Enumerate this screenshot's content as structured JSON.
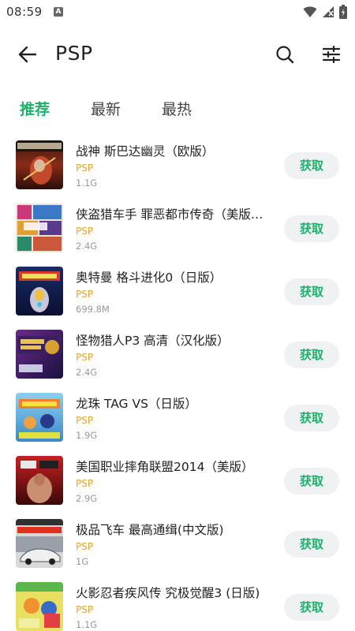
{
  "status_bar": {
    "time": "08:59",
    "notification_letter": "A",
    "icons": [
      "wifi-icon",
      "signal-icon",
      "battery-icon"
    ]
  },
  "header": {
    "title": "PSP",
    "back_icon": "arrow-left-icon",
    "search_icon": "search-icon",
    "filter_icon": "sliders-icon"
  },
  "tabs": [
    {
      "label": "推荐",
      "active": true
    },
    {
      "label": "最新",
      "active": false
    },
    {
      "label": "最热",
      "active": false
    }
  ],
  "colors": {
    "accent": "#1bb36a",
    "platform": "#e6a72a",
    "button_bg": "#f0f1f2"
  },
  "games": [
    {
      "title": "战神 斯巴达幽灵（欧版）",
      "platform": "PSP",
      "size": "1.1G",
      "button": "获取",
      "cover": "god-of-war-cover"
    },
    {
      "title": "侠盗猎车手 罪恶都市传奇（美版…",
      "platform": "PSP",
      "size": "2.4G",
      "button": "获取",
      "cover": "gta-vice-city-cover"
    },
    {
      "title": "奥特曼 格斗进化0（日版）",
      "platform": "PSP",
      "size": "699.8M",
      "button": "获取",
      "cover": "ultraman-cover"
    },
    {
      "title": "怪物猎人P3 高清（汉化版）",
      "platform": "PSP",
      "size": "2.4G",
      "button": "获取",
      "cover": "monster-hunter-cover"
    },
    {
      "title": "龙珠 TAG VS（日版）",
      "platform": "PSP",
      "size": "1.9G",
      "button": "获取",
      "cover": "dragon-ball-cover"
    },
    {
      "title": "美国职业摔角联盟2014（美版）",
      "platform": "PSP",
      "size": "2.9G",
      "button": "获取",
      "cover": "wwe-2k14-cover"
    },
    {
      "title": "极品飞车 最高通缉(中文版)",
      "platform": "PSP",
      "size": "1G",
      "button": "获取",
      "cover": "need-for-speed-cover"
    },
    {
      "title": "火影忍者疾风传 究极觉醒3 (日版)",
      "platform": "PSP",
      "size": "1.1G",
      "button": "获取",
      "cover": "naruto-cover"
    }
  ]
}
